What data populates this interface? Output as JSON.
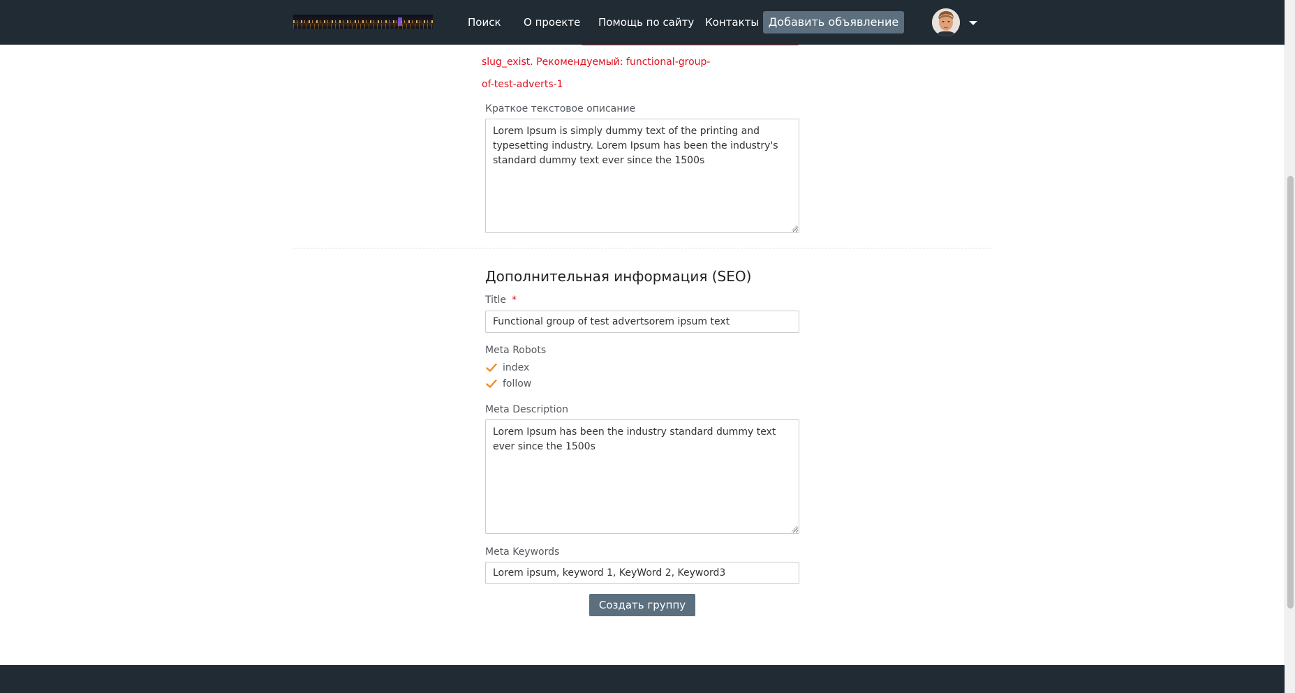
{
  "header": {
    "nav": [
      "Поиск",
      "О проекте",
      "Помощь по сайту",
      "Контакты"
    ],
    "add_listing_label": "Добавить объявление"
  },
  "form": {
    "slug_error": "slug_exist. Рекомендуемый: functional-group-of-test-adverts-1",
    "short_description": {
      "label": "Краткое текстовое описание",
      "value": "Lorem Ipsum is simply dummy text of the printing and typesetting industry. Lorem Ipsum has been the industry's standard dummy text ever since the 1500s"
    },
    "seo": {
      "heading": "Дополнительная информация (SEO)",
      "title_label": "Title",
      "title_required_mark": "*",
      "title_value": "Functional group of test advertsorem ipsum text",
      "robots_label": "Meta Robots",
      "robots": [
        {
          "label": "index",
          "checked": true
        },
        {
          "label": "follow",
          "checked": true
        }
      ],
      "description_label": "Meta Description",
      "description_value": "Lorem Ipsum has been the industry standard dummy text ever since the 1500s",
      "keywords_label": "Meta Keywords",
      "keywords_value": "Lorem ipsum, keyword 1, KeyWord 2, Keyword3"
    },
    "submit_label": "Создать группу"
  },
  "colors": {
    "header_bg": "#212b34",
    "button_bg": "#5b6f7e",
    "error": "#e0101e",
    "checkmark": "#f08a24"
  },
  "icons": [
    "site-logo",
    "user-avatar",
    "dropdown-caret-icon",
    "checkmark-icon"
  ]
}
